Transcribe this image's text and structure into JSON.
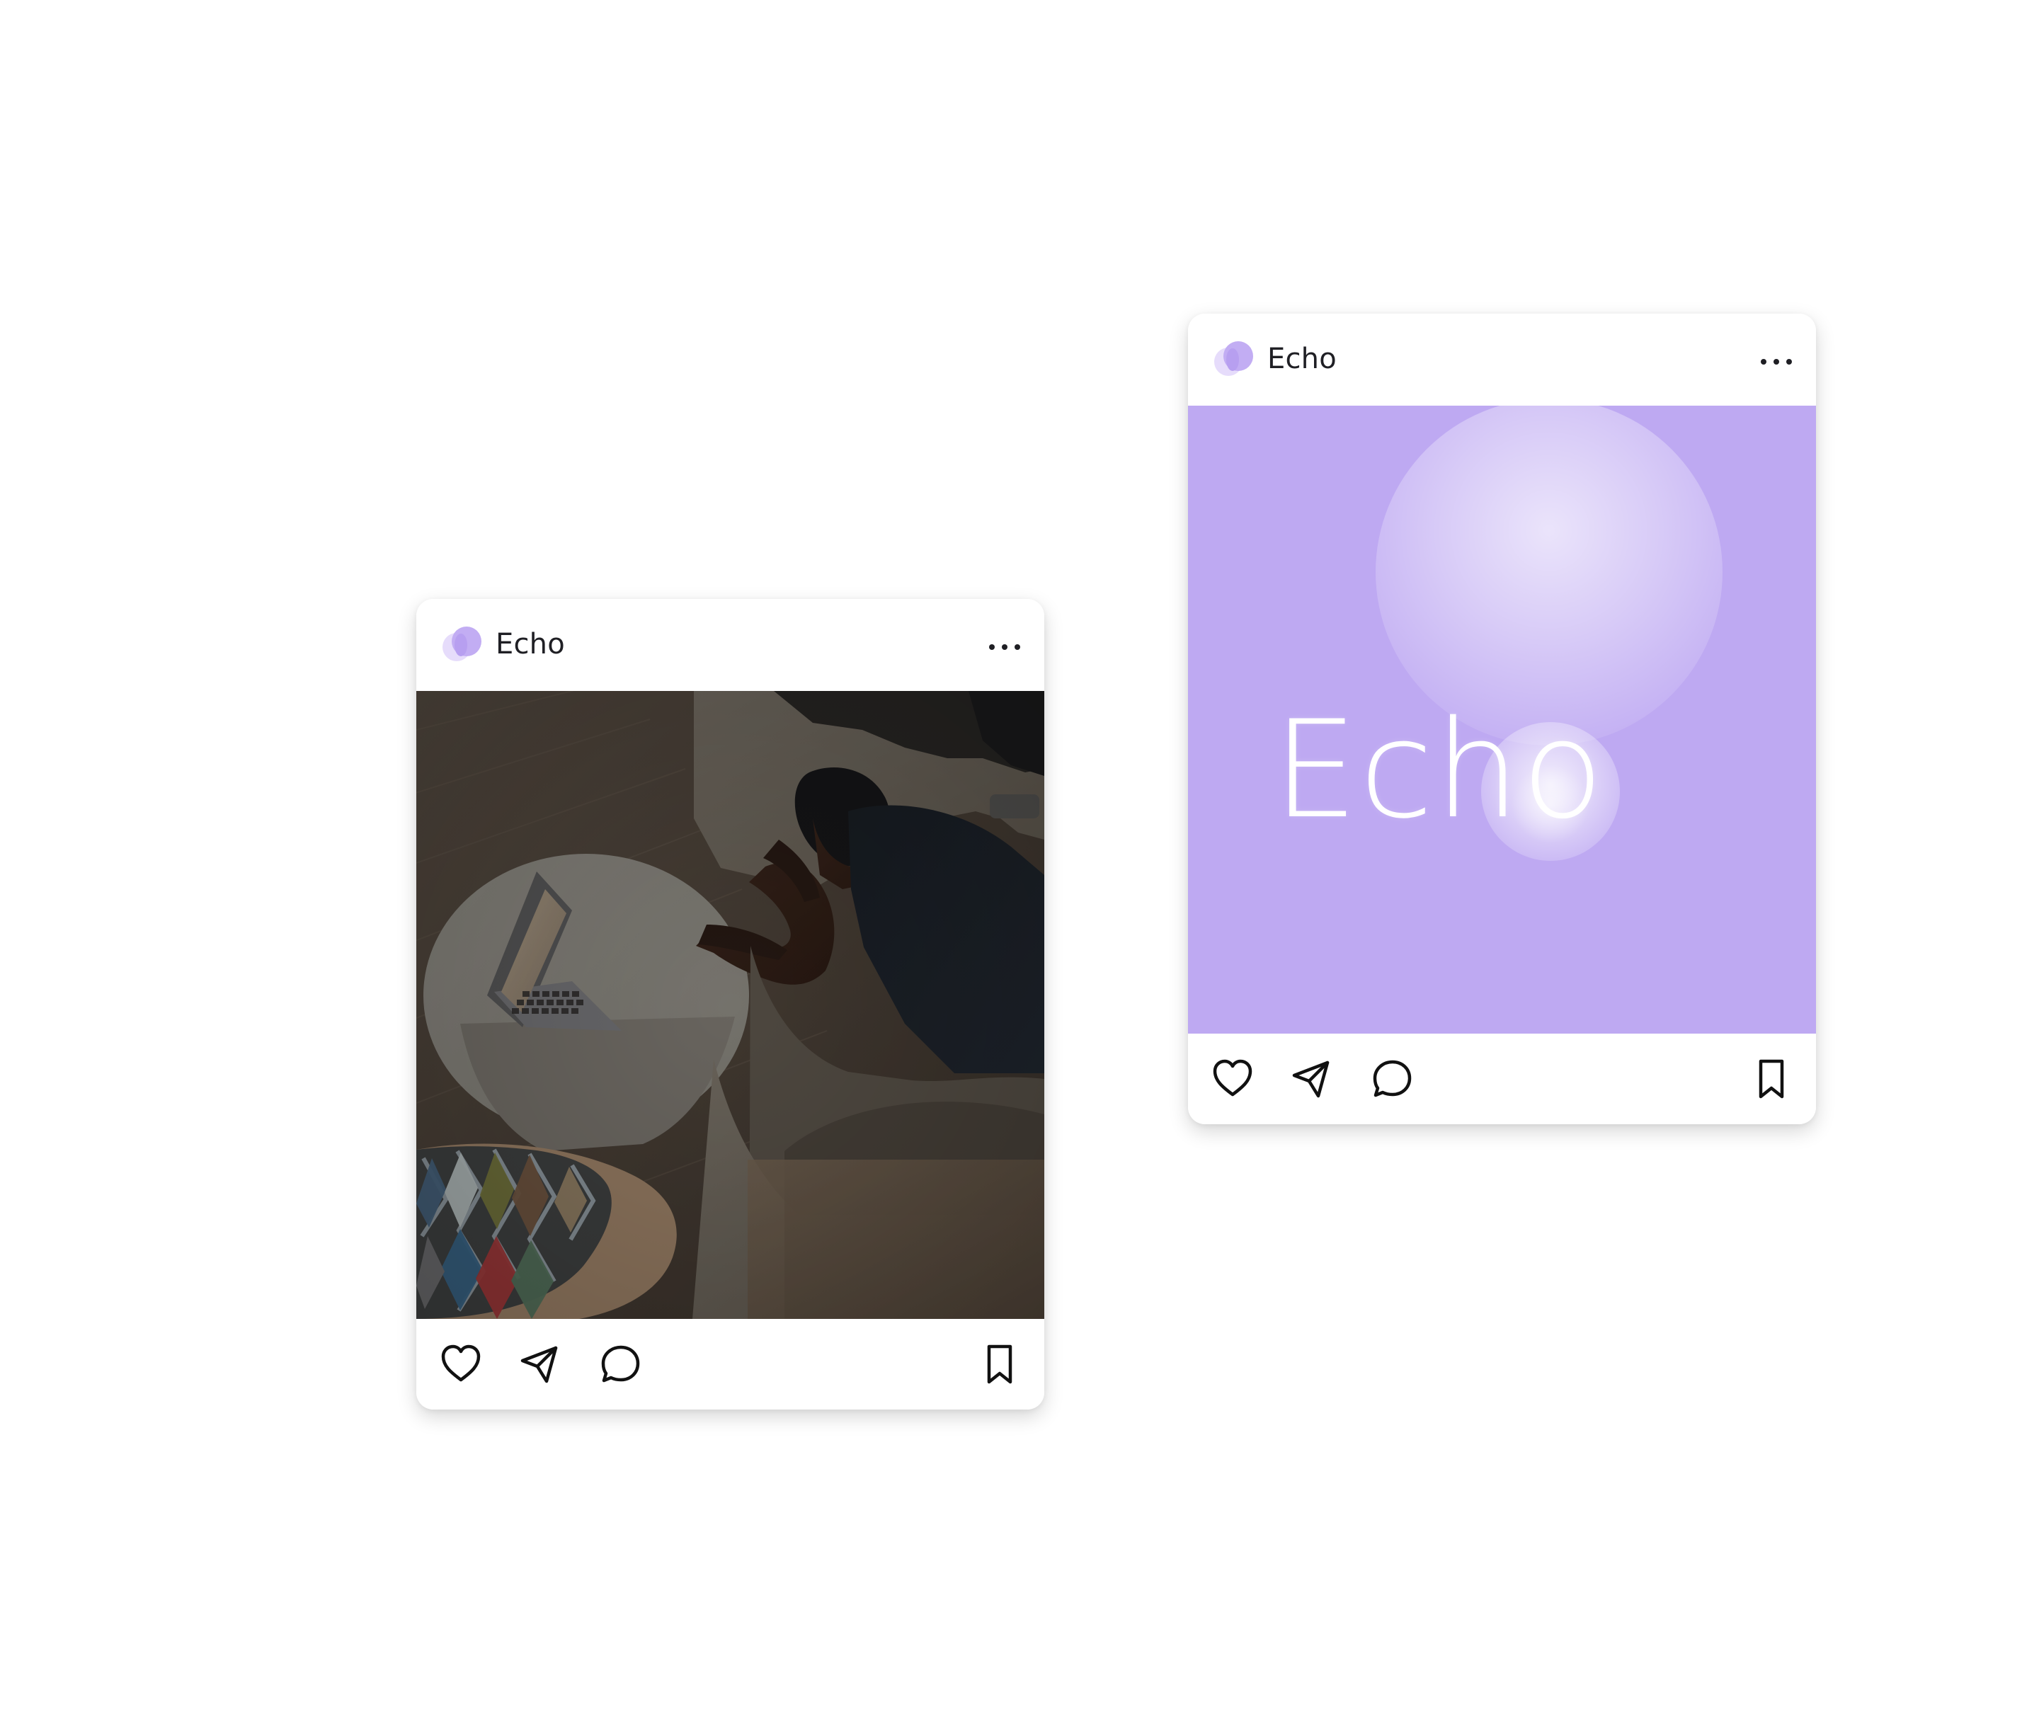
{
  "posts": [
    {
      "account_name": "Echo",
      "media_type": "photo",
      "icons": {
        "avatar": "brand-avatar-icon",
        "more": "more-options-icon",
        "like": "heart-icon",
        "share": "send-icon",
        "comment": "comment-bubble-icon",
        "save": "bookmark-icon"
      }
    },
    {
      "account_name": "Echo",
      "media_type": "brand-graphic",
      "media_text": "Echo",
      "icons": {
        "avatar": "brand-avatar-icon",
        "more": "more-options-icon",
        "like": "heart-icon",
        "share": "send-icon",
        "comment": "comment-bubble-icon",
        "save": "bookmark-icon"
      }
    }
  ],
  "colors": {
    "background": "#ffffff",
    "brand_purple": "#bea9f2",
    "text_dark": "#1f1f24"
  }
}
